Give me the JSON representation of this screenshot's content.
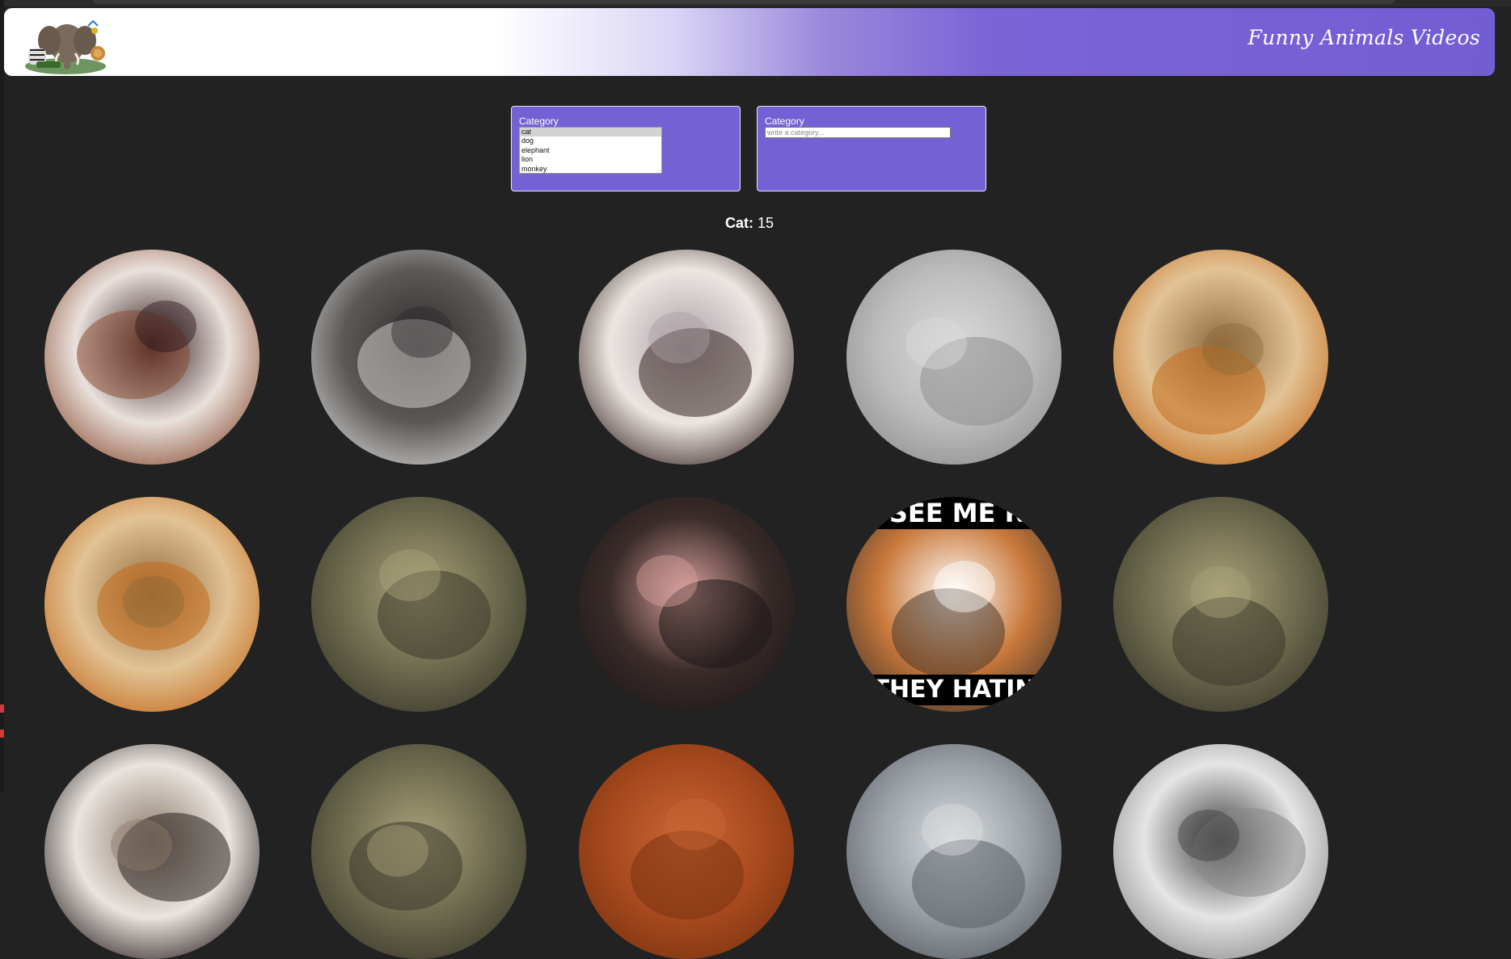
{
  "header": {
    "site_title": "Funny Animals Videos",
    "logo_name": "animals-logo"
  },
  "filters": {
    "select_panel": {
      "label": "Category",
      "options": [
        "cat",
        "dog",
        "elephant",
        "lion",
        "monkey"
      ],
      "selected": "cat"
    },
    "search_panel": {
      "label": "Category",
      "placeholder": "write a category..."
    }
  },
  "result_count": {
    "label": "Cat:",
    "value": "15"
  },
  "videos": [
    {
      "name": "video-thumb-1",
      "palette": [
        "#e9e1dc",
        "#8b4f35",
        "#2a1418"
      ]
    },
    {
      "name": "video-thumb-2",
      "palette": [
        "#5c5a58",
        "#cfcdcc",
        "#2d2b2a"
      ]
    },
    {
      "name": "video-thumb-3",
      "palette": [
        "#ece6e2",
        "#3b2a26",
        "#aaa0a6"
      ]
    },
    {
      "name": "video-thumb-4",
      "palette": [
        "#bcbcbc",
        "#8f8f8f",
        "#dadada"
      ]
    },
    {
      "name": "video-thumb-5",
      "palette": [
        "#e2c395",
        "#c46b1e",
        "#8e6a3c"
      ]
    },
    {
      "name": "video-thumb-6",
      "palette": [
        "#e2c395",
        "#c46b1e",
        "#8e6a3c"
      ]
    },
    {
      "name": "video-thumb-7",
      "palette": [
        "#6d6a4e",
        "#3c3a2c",
        "#a9a27a"
      ]
    },
    {
      "name": "video-thumb-8",
      "palette": [
        "#3a2c2a",
        "#1d1818",
        "#d89f9b"
      ]
    },
    {
      "name": "video-thumb-9",
      "palette": [
        "#c9783a",
        "#4a3a2e",
        "#ffffff"
      ],
      "caption_top": "Y SEE ME RO",
      "caption_bottom": "THEY HATIN"
    },
    {
      "name": "video-thumb-10",
      "palette": [
        "#6d6a4e",
        "#3c3a2c",
        "#a9a27a"
      ]
    },
    {
      "name": "video-thumb-11",
      "palette": [
        "#e9e4df",
        "#2a2221",
        "#8b7a6a"
      ]
    },
    {
      "name": "video-thumb-12",
      "palette": [
        "#6d6a4e",
        "#3c3a2c",
        "#a9a27a"
      ]
    },
    {
      "name": "video-thumb-13",
      "palette": [
        "#a84a1e",
        "#7a3311",
        "#c96636"
      ]
    },
    {
      "name": "video-thumb-14",
      "palette": [
        "#9aa0a6",
        "#5a5f66",
        "#d9dde0"
      ]
    },
    {
      "name": "video-thumb-15",
      "palette": [
        "#e5e5e5",
        "#8a8a8a",
        "#3b3b3b"
      ]
    }
  ]
}
